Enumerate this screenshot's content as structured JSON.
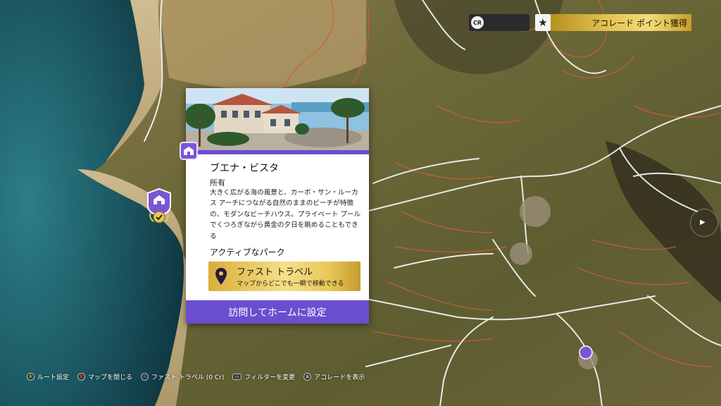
{
  "hud": {
    "cr_icon": "CR",
    "star_icon": "★",
    "accolade_label": "アコレード ポイント獲得"
  },
  "card": {
    "title": "ブエナ・ビスタ",
    "status": "所有",
    "description": "大きく広がる海の風景と、カーボ・サン・ルーカス アーチにつながる自然のままのビーチが特徴の、モダンなビーチハウス。プライベート プールでくつろぎながら黄金の夕日を眺めることもできる",
    "active_perk_heading": "アクティブなパーク",
    "fast_travel_label": "ファスト トラベル",
    "fast_travel_sub": "マップからどこでも一瞬で移動できる",
    "action_label": "訪問してホームに設定"
  },
  "hints": [
    {
      "key": "A",
      "label": "ルート設定",
      "color": "#6bbf3a",
      "icon": "a-button-icon"
    },
    {
      "key": "B",
      "label": "マップを閉じる",
      "color": "#d9443a",
      "icon": "b-button-icon"
    },
    {
      "key": "X",
      "label": "ファスト トラベル (0 Cr)",
      "color": "#3a7fd9",
      "icon": "x-button-icon"
    },
    {
      "key": "▭",
      "label": "フィルターを変更",
      "color": "#cccccc",
      "icon": "view-button-icon"
    },
    {
      "key": "≡",
      "label": "アコレードを表示",
      "color": "#cccccc",
      "icon": "menu-button-icon"
    }
  ],
  "colors": {
    "accent_purple": "#6a4ed0",
    "gold": "#e7c65a",
    "ocean": "#1d5a68",
    "land": "#6e6a3a"
  }
}
